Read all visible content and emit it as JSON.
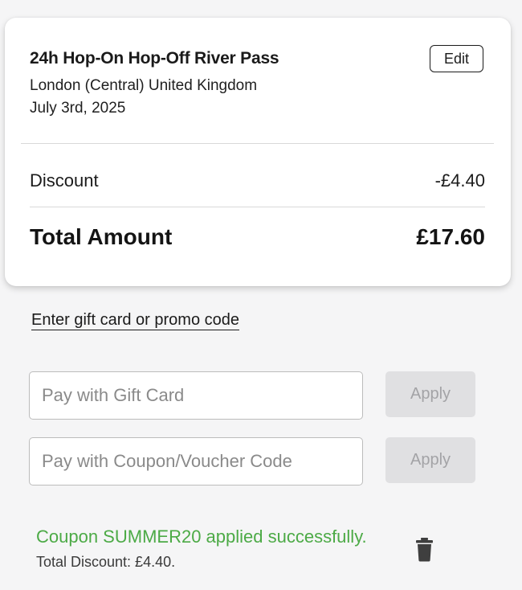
{
  "booking": {
    "title": "24h Hop-On Hop-Off River Pass",
    "location": "London (Central) United Kingdom",
    "date": "July 3rd, 2025",
    "edit_label": "Edit"
  },
  "summary": {
    "discount_label": "Discount",
    "discount_value": "-£4.40",
    "total_label": "Total Amount",
    "total_value": "£17.60"
  },
  "promo": {
    "link_label": "Enter gift card or promo code",
    "gift_card": {
      "placeholder": "Pay with Gift Card",
      "value": "",
      "apply_label": "Apply"
    },
    "coupon": {
      "placeholder": "Pay with Coupon/Voucher Code",
      "value": "",
      "apply_label": "Apply"
    }
  },
  "status": {
    "success_message": "Coupon SUMMER20 applied successfully.",
    "total_discount": "Total Discount: £4.40.",
    "remove_icon": "trash-icon"
  },
  "colors": {
    "success": "#4caa46",
    "apply_disabled_bg": "#e0e0e2",
    "apply_disabled_text": "#a3a3a6",
    "trash_icon": "#3f3f3f"
  }
}
